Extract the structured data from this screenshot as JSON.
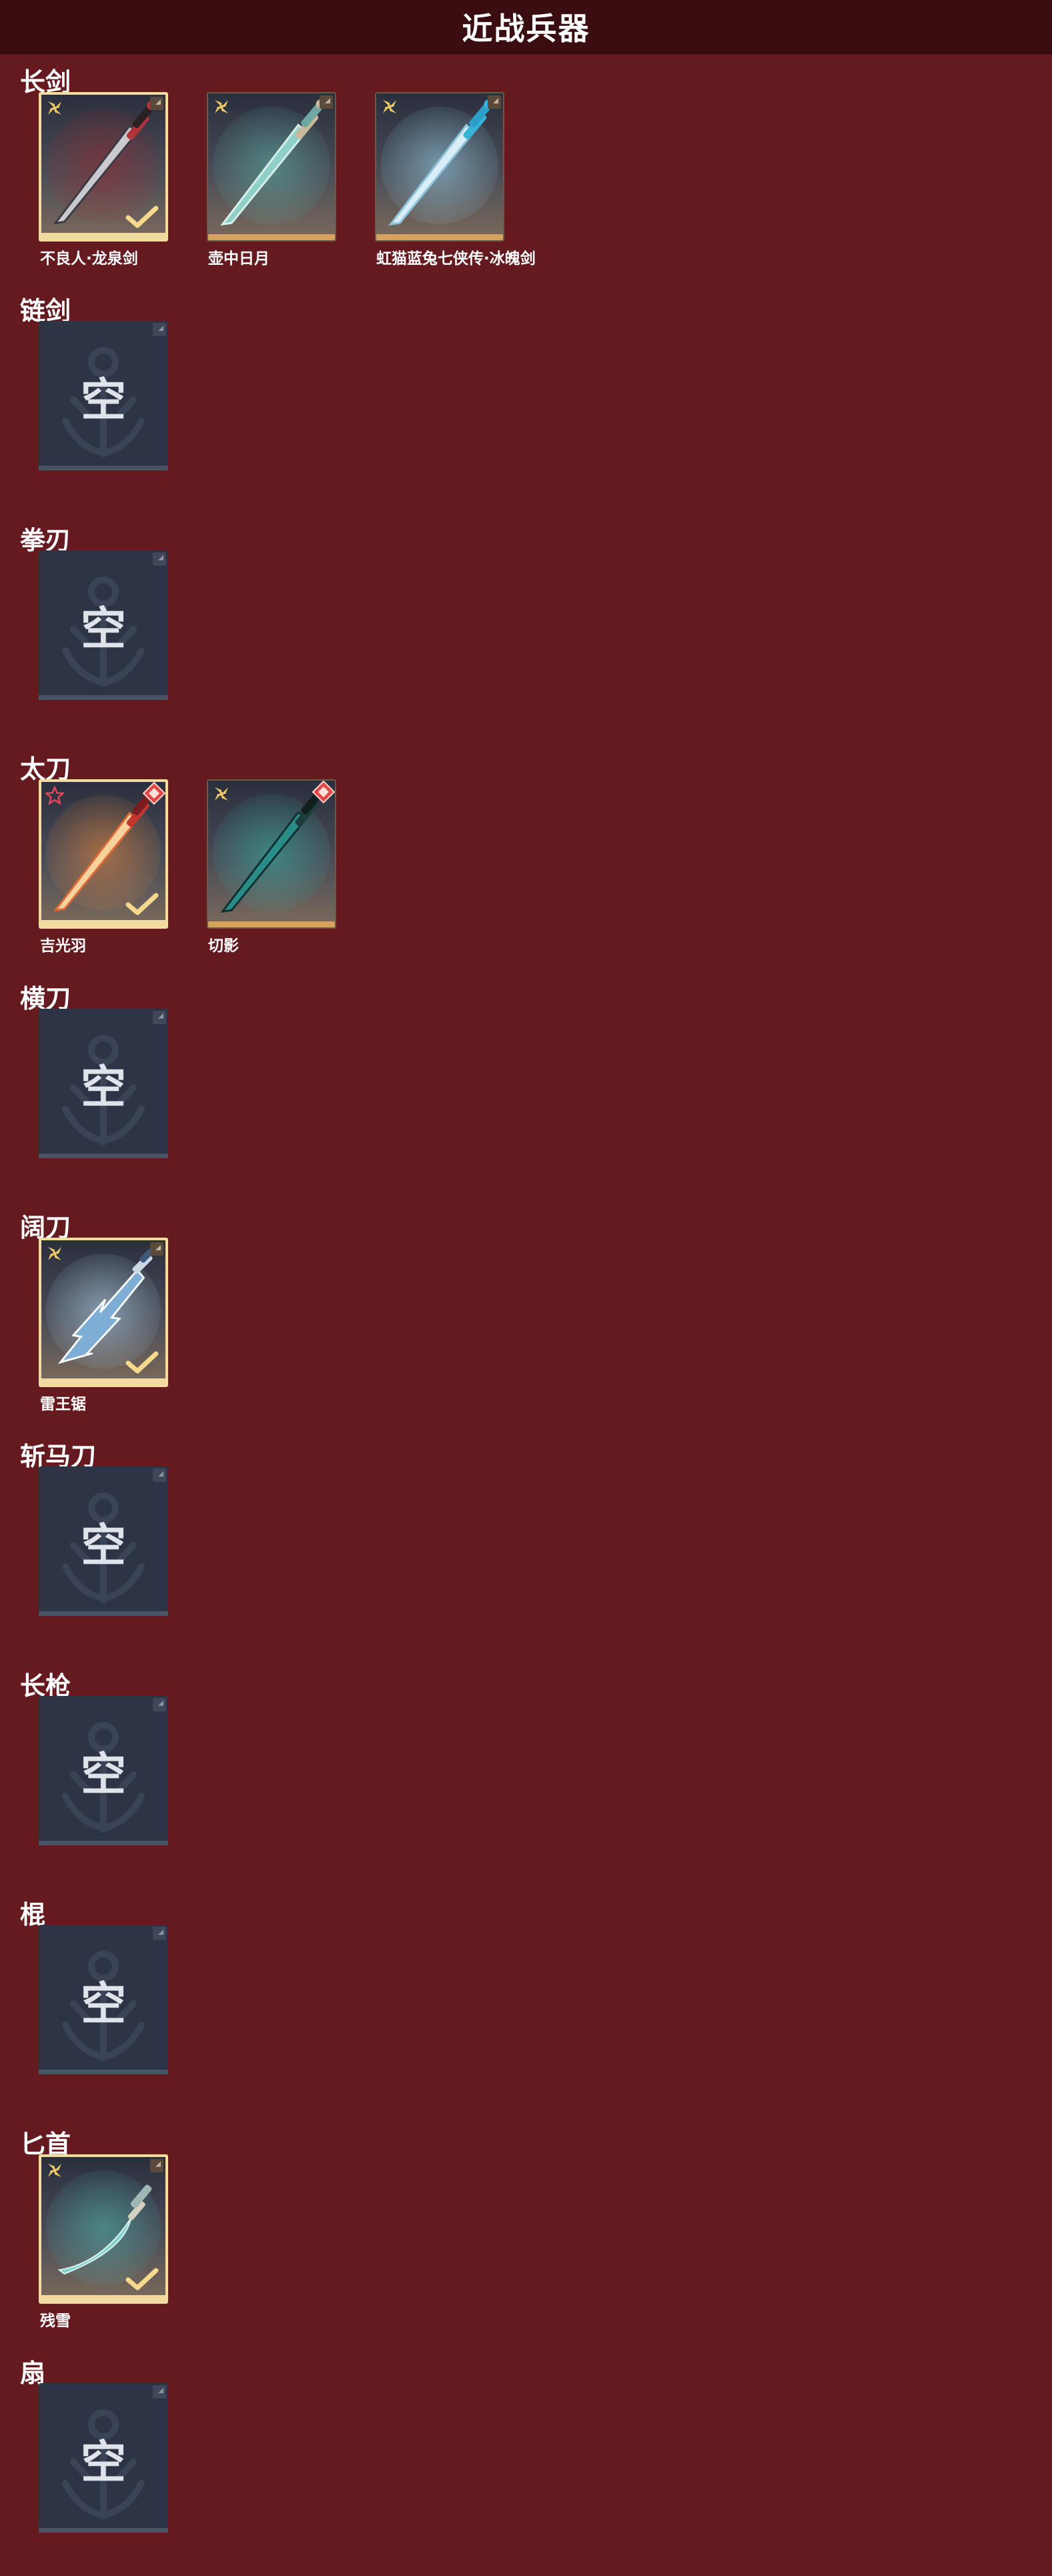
{
  "header": {
    "title": "近战兵器"
  },
  "colors": {
    "background": "#651a1f",
    "header": "#3a0d11",
    "equipped_border": "#f3dca0",
    "empty_slot": "#2d3445"
  },
  "sections": [
    {
      "title": "长剑",
      "items": [
        {
          "name": "不良人·龙泉剑",
          "equipped": true,
          "quality_icon": "gold-shuriken-icon",
          "art": "sword-dark-red"
        },
        {
          "name": "壶中日月",
          "equipped": false,
          "quality_icon": "gold-shuriken-icon",
          "art": "sword-jade"
        },
        {
          "name": "虹猫蓝兔七侠传·冰魄剑",
          "equipped": false,
          "quality_icon": "gold-shuriken-icon",
          "art": "sword-ice"
        }
      ]
    },
    {
      "title": "链剑",
      "empty_label": "空"
    },
    {
      "title": "拳刃",
      "empty_label": "空"
    },
    {
      "title": "太刀",
      "items": [
        {
          "name": "吉光羽",
          "equipped": true,
          "quality_icon": "red-star-icon",
          "red_badge": true,
          "art": "blade-fire"
        },
        {
          "name": "切影",
          "equipped": false,
          "quality_icon": "gold-shuriken-icon",
          "red_badge": true,
          "art": "blade-teal"
        }
      ]
    },
    {
      "title": "横刀",
      "empty_label": "空"
    },
    {
      "title": "阔刀",
      "items": [
        {
          "name": "雷王锯",
          "equipped": true,
          "quality_icon": "gold-shuriken-icon",
          "art": "broadblade-lightning"
        }
      ]
    },
    {
      "title": "斩马刀",
      "empty_label": "空"
    },
    {
      "title": "长枪",
      "empty_label": "空"
    },
    {
      "title": "棍",
      "empty_label": "空"
    },
    {
      "title": "匕首",
      "items": [
        {
          "name": "残雪",
          "equipped": true,
          "quality_icon": "gold-shuriken-icon",
          "art": "dagger-curved"
        }
      ]
    },
    {
      "title": "扇",
      "empty_label": "空"
    }
  ]
}
